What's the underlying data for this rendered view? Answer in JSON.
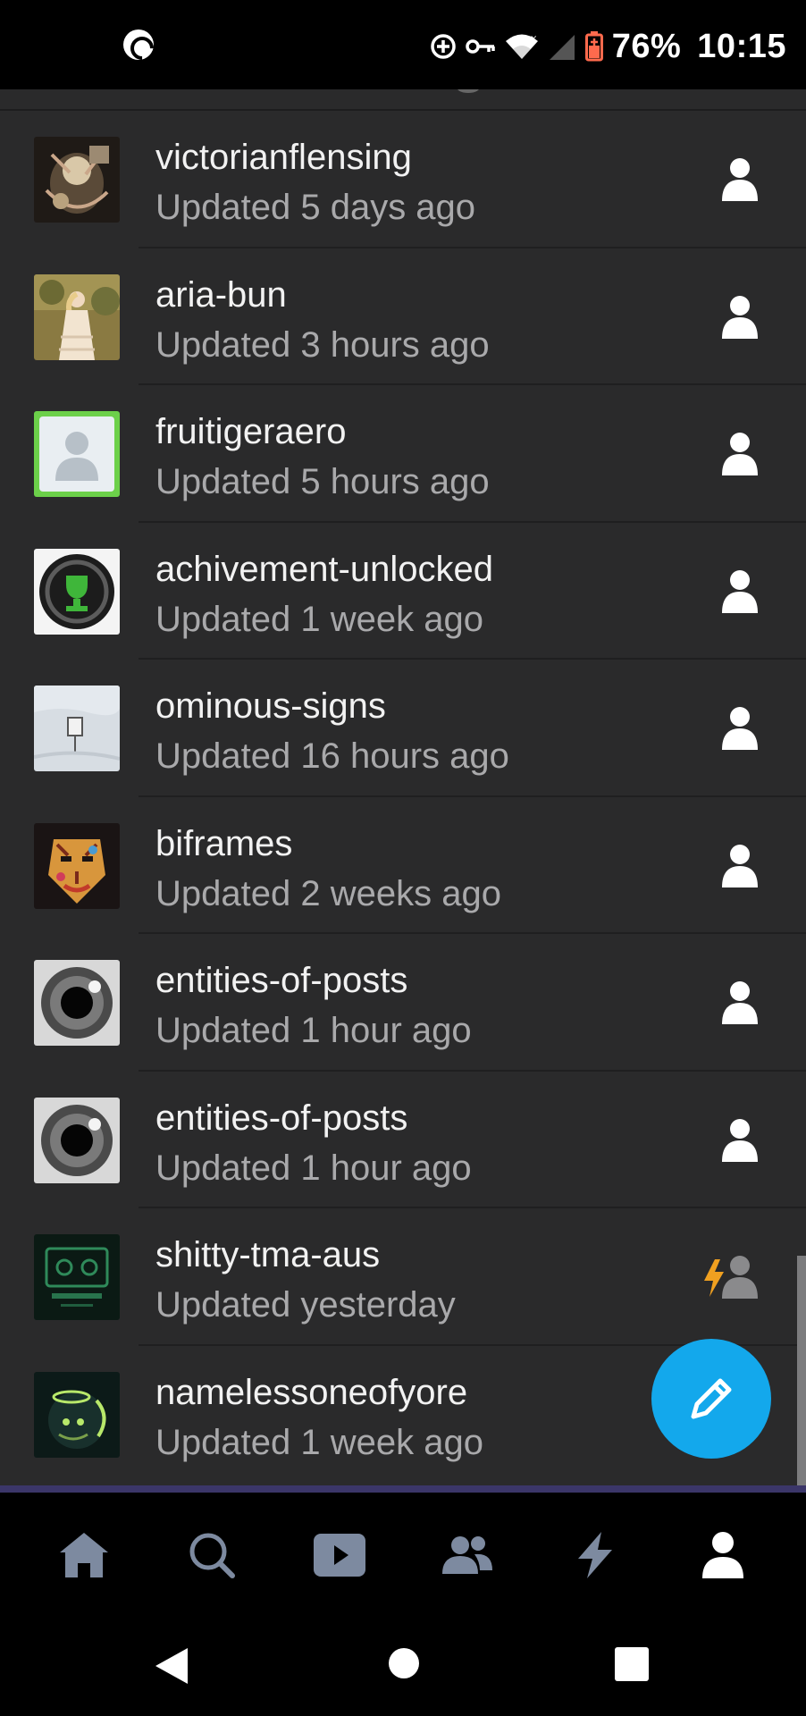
{
  "status_bar": {
    "battery": "76%",
    "time": "10:15",
    "icons": [
      "app-icon",
      "data-saver-icon",
      "vpn-key-icon",
      "wifi-icon",
      "cell-signal-icon",
      "battery-icon"
    ]
  },
  "blogs": [
    {
      "name": "victorianflensing",
      "updated": "Updated 5 days ago",
      "avatar": "ornate-illustration",
      "follow": "person-icon"
    },
    {
      "name": "aria-bun",
      "updated": "Updated 3 hours ago",
      "avatar": "girl-in-dress-photo",
      "follow": "person-icon"
    },
    {
      "name": "fruitigeraero",
      "updated": "Updated 5 hours ago",
      "avatar": "green-user-icon",
      "follow": "person-icon"
    },
    {
      "name": "achivement-unlocked",
      "updated": "Updated 1 week ago",
      "avatar": "trophy-badge",
      "follow": "person-icon"
    },
    {
      "name": "ominous-signs",
      "updated": "Updated 16 hours ago",
      "avatar": "snow-sign-photo",
      "follow": "person-icon"
    },
    {
      "name": "biframes",
      "updated": "Updated 2 weeks ago",
      "avatar": "tiger-mask",
      "follow": "person-icon"
    },
    {
      "name": "entities-of-posts",
      "updated": "Updated 1 hour ago",
      "avatar": "eye-closeup",
      "follow": "person-icon"
    },
    {
      "name": "entities-of-posts",
      "updated": "Updated 1 hour ago",
      "avatar": "eye-closeup",
      "follow": "person-icon"
    },
    {
      "name": "shitty-tma-aus",
      "updated": "Updated yesterday",
      "avatar": "magnus-archives-tape",
      "follow": "lightning-person-icon"
    },
    {
      "name": "namelessoneofyore",
      "updated": "Updated 1 week ago",
      "avatar": "halo-creature",
      "follow": "none"
    }
  ],
  "fab": {
    "icon": "pencil-icon"
  },
  "bottom_nav": [
    "home-icon",
    "search-icon",
    "video-icon",
    "people-icon",
    "lightning-icon",
    "account-icon"
  ],
  "colors": {
    "background": "#2a2a2b",
    "fab": "#13a8ec",
    "accent_line": "#3b3669",
    "nav_inactive": "#7d8aa0",
    "lightning": "#f0a020"
  }
}
